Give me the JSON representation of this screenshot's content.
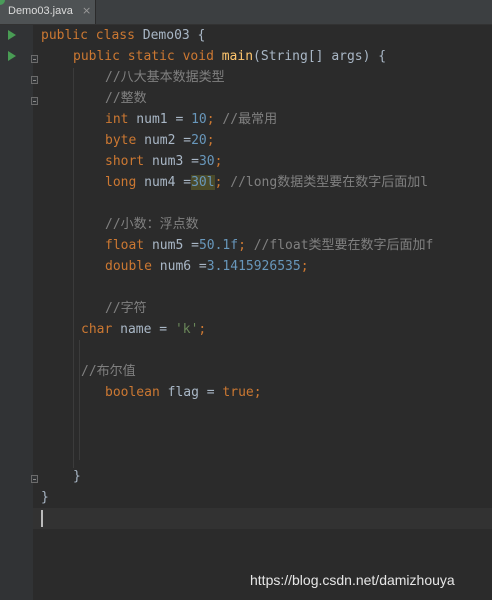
{
  "tab": {
    "label": "Demo03.java",
    "close": "×"
  },
  "code": {
    "l1": {
      "k1": "public",
      "k2": "class",
      "name": "Demo03",
      "brace": " {"
    },
    "l2": {
      "k1": "public",
      "k2": "static",
      "k3": "void",
      "fn": "main",
      "args": "(String[] args) {"
    },
    "l3": {
      "c": "//八大基本数据类型"
    },
    "l4": {
      "c": "//整数"
    },
    "l5": {
      "t": "int",
      "v": " num1 = ",
      "n": "10",
      "s": "; ",
      "c": "//最常用"
    },
    "l6": {
      "t": "byte",
      "v": " num2 =",
      "n": "20",
      "s": ";"
    },
    "l7": {
      "t": "short",
      "v": " num3 =",
      "n": "30",
      "s": ";"
    },
    "l8": {
      "t": "long",
      "v": " num4 =",
      "n": "30l",
      "s": "; ",
      "c": "//long数据类型要在数字后面加l"
    },
    "l9": {
      "c": "//小数：浮点数"
    },
    "l10": {
      "t": "float",
      "v": " num5 =",
      "n": "50.1f",
      "s": "; ",
      "c": "//float类型要在数字后面加f"
    },
    "l11": {
      "t": "double",
      "v": " num6 =",
      "n": "3.1415926535",
      "s": ";"
    },
    "l12": {
      "c": "//字符"
    },
    "l13": {
      "t": "char",
      "v": " name = ",
      "str": "'k'",
      "s": ";"
    },
    "l14": {
      "c": "//布尔值"
    },
    "l15": {
      "t": "boolean",
      "v": " flag = ",
      "k": "true",
      "s": ";"
    },
    "l16": {
      "brace": "}"
    },
    "l17": {
      "brace": "}"
    }
  },
  "icons": {
    "run": "run-icon",
    "fold": "fold-icon"
  },
  "colors": {
    "keyword": "#cc7832",
    "number": "#6897bb",
    "comment": "#808080",
    "string": "#6a8759",
    "method": "#ffc66d",
    "text": "#a9b7c6",
    "background": "#2b2b2b"
  },
  "watermark": "https://blog.csdn.net/damizhouya"
}
